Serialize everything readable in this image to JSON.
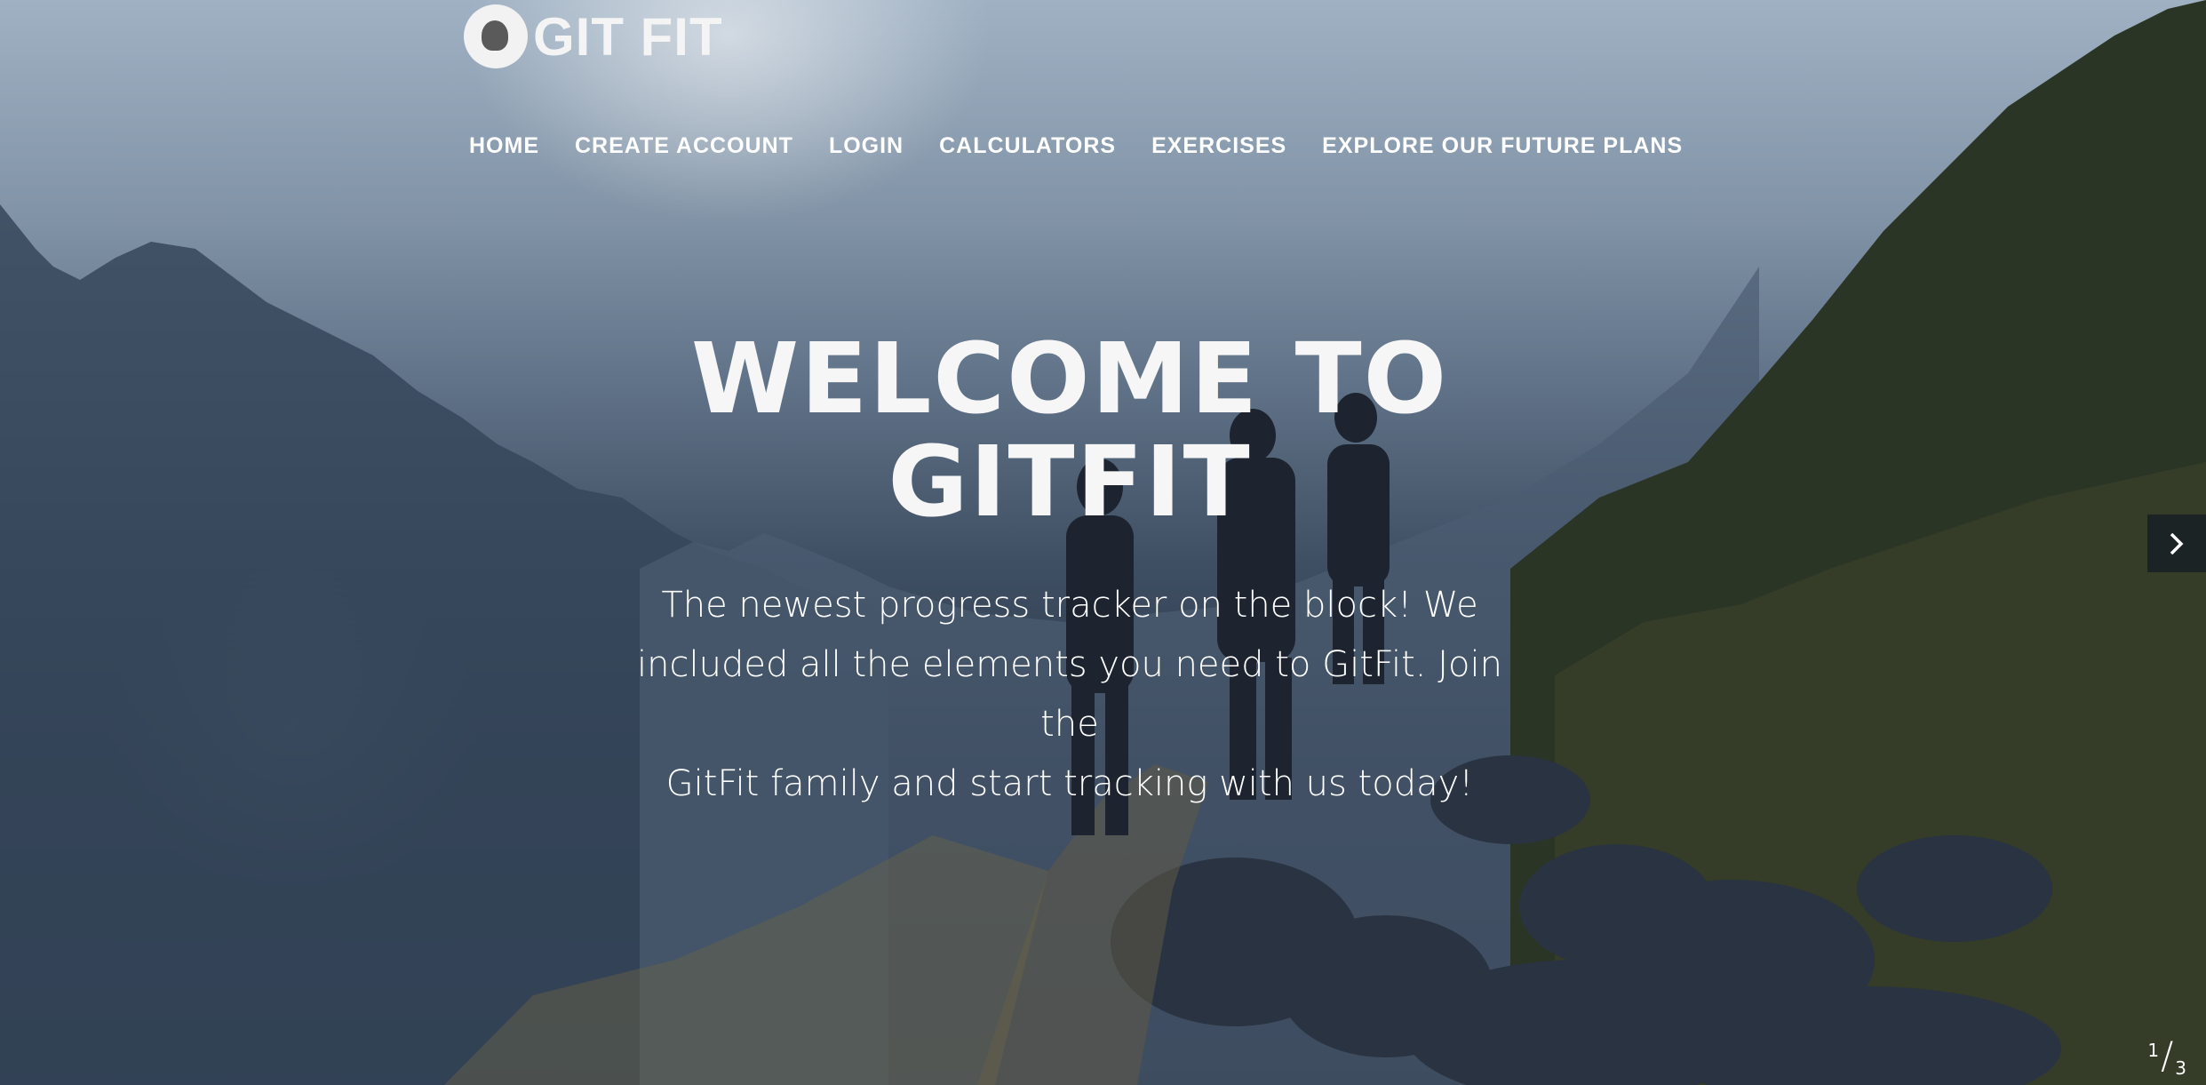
{
  "brand": {
    "name": "GIT FIT",
    "logo_icon": "gitfit-octocat-logo"
  },
  "nav": {
    "items": [
      {
        "label": "HOME"
      },
      {
        "label": "CREATE ACCOUNT"
      },
      {
        "label": "LOGIN"
      },
      {
        "label": "CALCULATORS"
      },
      {
        "label": "EXERCISES"
      },
      {
        "label": "EXPLORE OUR FUTURE PLANS"
      }
    ]
  },
  "hero": {
    "title_line1": "WELCOME TO",
    "title_line2": "GITFIT",
    "text_line1": "The newest progress tracker on the block! We",
    "text_line2": "included all the elements you need to GitFit. Join the",
    "text_line3": "GitFit family and start tracking with us today!"
  },
  "slider": {
    "current": "1",
    "total": "3",
    "next_icon": "chevron-right-icon"
  },
  "colors": {
    "text": "#ffffff",
    "overlay": "#2b3648",
    "arrow_bg": "#141c24"
  }
}
